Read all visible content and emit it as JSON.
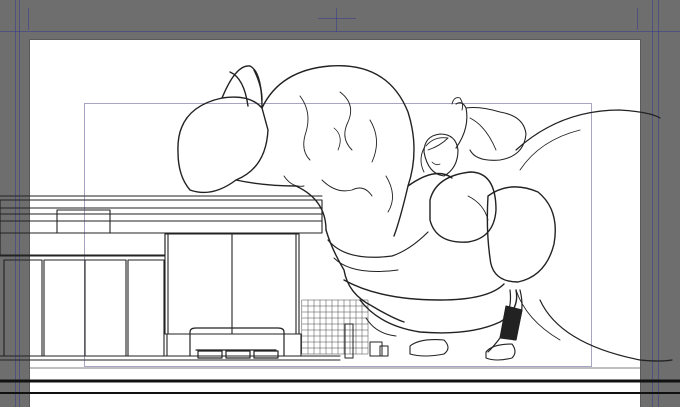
{
  "canvas": {
    "background_color": "#6e6e6e",
    "paper_color": "#ffffff",
    "guide_color": "#3a3a8a",
    "line_color": "#222222"
  },
  "artwork": {
    "style": "lineart-sketch",
    "subjects": [
      "giant-character",
      "small-figure",
      "storefront",
      "tail",
      "fence",
      "bench"
    ]
  }
}
